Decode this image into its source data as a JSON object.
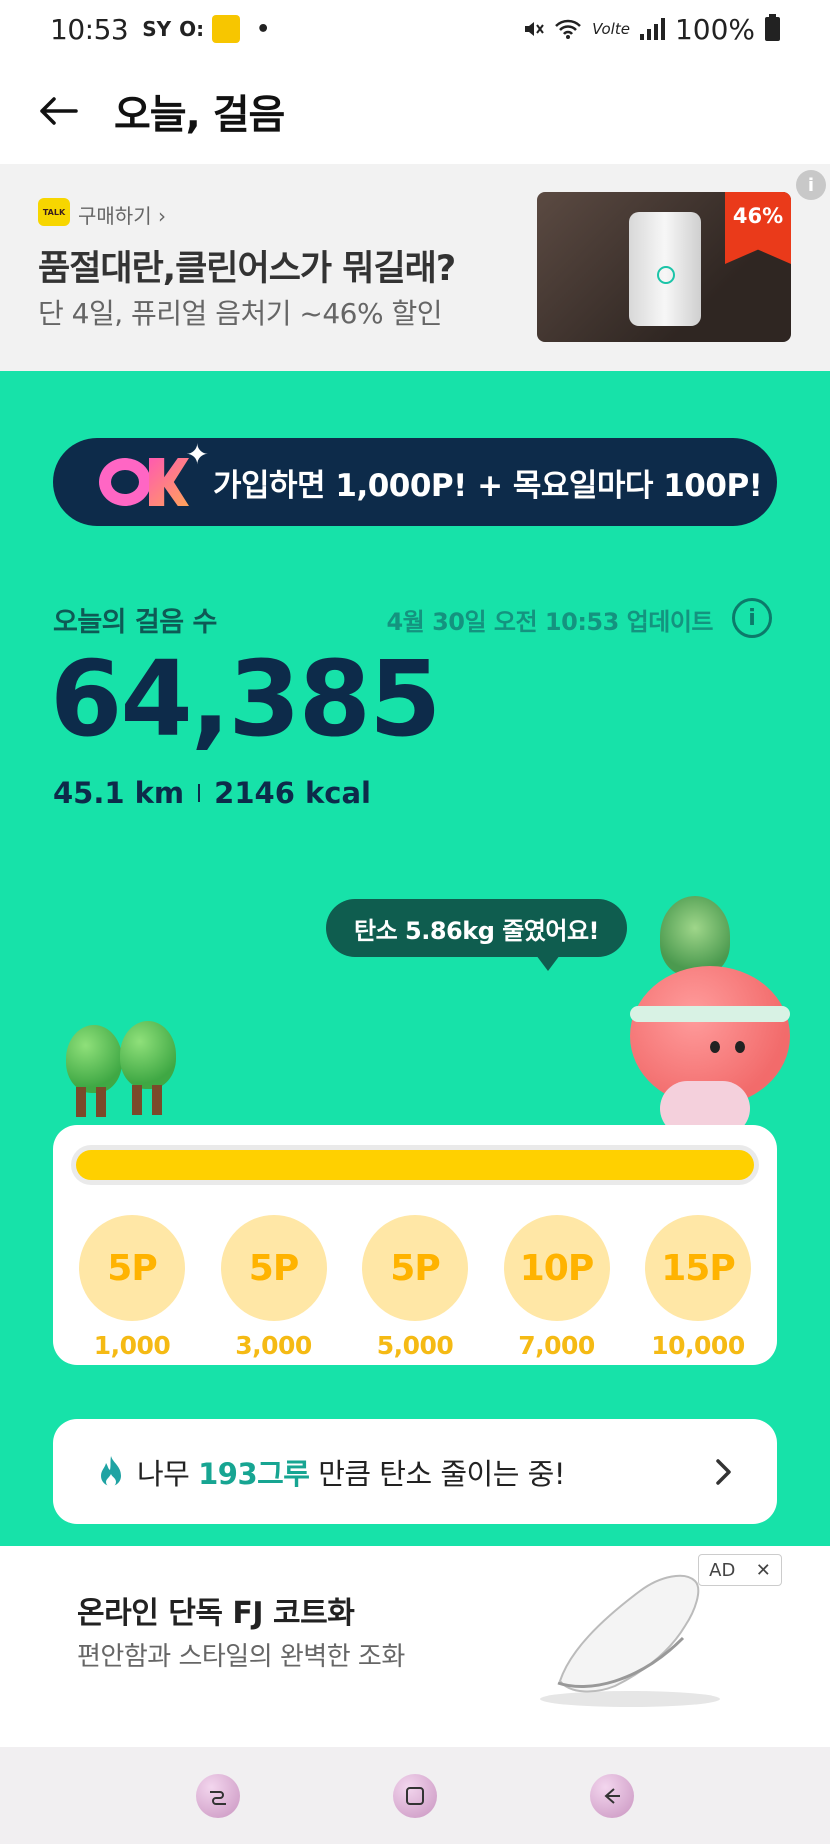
{
  "status_bar": {
    "time": "10:53",
    "indicator_sy": "SY",
    "indicator_ok": "O:",
    "dot": "•",
    "network_label": "Volte",
    "battery": "100%"
  },
  "header": {
    "title": "오늘, 걸음"
  },
  "top_ad": {
    "talk_badge": "TALK",
    "buy_link": "구매하기 ›",
    "headline": "품절대란,클린어스가 뭐길래?",
    "subline": "단 4일, 퓨리얼 음처기 ~46% 할인",
    "discount_badge": "46%",
    "info_symbol": "i"
  },
  "promo": {
    "text": "가입하면 1,000P! + 목요일마다 100P!"
  },
  "stats": {
    "label": "오늘의 걸음 수",
    "update_text": "4월 30일 오전 10:53 업데이트",
    "info_symbol": "i",
    "steps": "64,385",
    "distance": "45.1 km",
    "calories": "2146 kcal"
  },
  "bubble": {
    "text": "탄소 5.86kg 줄였어요!"
  },
  "progress": {
    "fill_fraction": 1.0,
    "milestones": [
      {
        "points": "5P",
        "steps": "1,000"
      },
      {
        "points": "5P",
        "steps": "3,000"
      },
      {
        "points": "5P",
        "steps": "5,000"
      },
      {
        "points": "10P",
        "steps": "7,000"
      },
      {
        "points": "15P",
        "steps": "10,000"
      }
    ]
  },
  "tree_card": {
    "prefix": "나무",
    "highlight": "193그루",
    "suffix": "만큼 탄소 줄이는 중!"
  },
  "bottom_ad": {
    "title": "온라인 단독 FJ 코트화",
    "subtitle": "편안함과 스타일의 완벽한 조화",
    "ad_label": "AD",
    "close_symbol": "✕"
  },
  "colors": {
    "mint": "#17e2a9",
    "navy": "#0d2b4a",
    "yellow": "#ffd000",
    "coin_bg": "#ffe7a6",
    "teal_text": "#17a592"
  },
  "icons": [
    "back-arrow-icon",
    "flame-icon",
    "chevron-right-icon",
    "info-icon",
    "recents-icon",
    "home-icon",
    "nav-back-icon"
  ]
}
